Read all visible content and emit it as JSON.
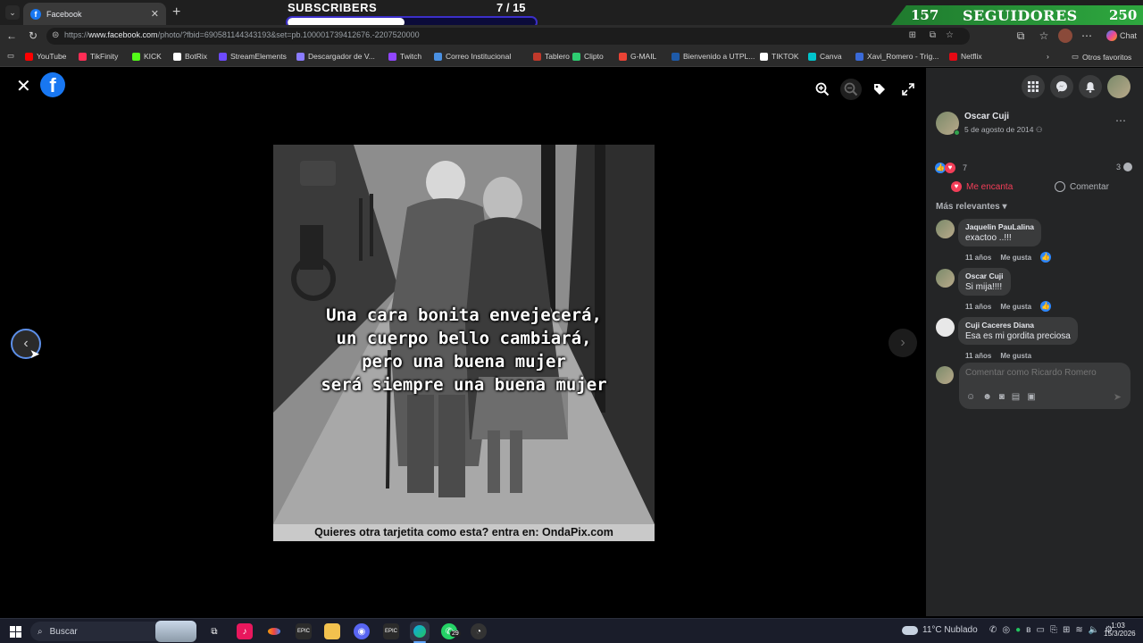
{
  "browser": {
    "tab_title": "Facebook",
    "url_prefix": "https://",
    "url_domain": "www.facebook.com",
    "url_path": "/photo/?fbid=690581144343193&set=pb.100001739412676.-2207520000",
    "chat_label": "Chat"
  },
  "overlay": {
    "subscribers_label": "SUBSCRIBERS",
    "subscribers_count": "7  / 15",
    "subscribers_progress": 0.47,
    "followers_current": "157",
    "followers_label": "SEGUIDORES",
    "followers_goal": "250"
  },
  "bookmarks": [
    {
      "label": "YouTube",
      "color": "#ff0000"
    },
    {
      "label": "TikFinity",
      "color": "#ff2d55"
    },
    {
      "label": "KICK",
      "color": "#53fc18"
    },
    {
      "label": "BotRix",
      "color": "#ffffff"
    },
    {
      "label": "StreamElements",
      "color": "#6d4aff"
    },
    {
      "label": "Descargador de V...",
      "color": "#8a7bff"
    },
    {
      "label": "Twitch",
      "color": "#9146ff"
    },
    {
      "label": "Correo Institucional",
      "color": "#4a90e2"
    },
    {
      "label": "Tablero",
      "color": "#c0392b"
    },
    {
      "label": "Clipto",
      "color": "#2ecc71"
    },
    {
      "label": "G-MAIL",
      "color": "#ea4335"
    },
    {
      "label": "Bienvenido a UTPL...",
      "color": "#1e5aa8"
    },
    {
      "label": "TIKTOK",
      "color": "#ffffff"
    },
    {
      "label": "Canva",
      "color": "#00c4cc"
    },
    {
      "label": "Xavi_Romero - Trig...",
      "color": "#3a6ad8"
    },
    {
      "label": "Netflix",
      "color": "#e50914"
    }
  ],
  "bookmarks_other": "Otros favoritos",
  "photo": {
    "caption_lines": [
      "Una cara bonita envejecerá,",
      "un cuerpo bello cambiará,",
      "pero una buena mujer",
      "será siempre una buena mujer"
    ],
    "footer": "Quieres otra tarjetita como esta? entra en: OndaPix.com"
  },
  "post": {
    "author": "Oscar Cuji",
    "date": "5 de agosto de 2014",
    "reactions_count": "7",
    "comments_count": "3",
    "love_label": "Me encanta",
    "comment_label": "Comentar",
    "sort_label": "Más relevantes",
    "comments": [
      {
        "name": "Jaquelin PauLalina",
        "text": "exactoo ..!!!",
        "time": "11 años",
        "like": "Me gusta"
      },
      {
        "name": "Oscar Cuji",
        "text": "Si mija!!!!",
        "time": "11 años",
        "like": "Me gusta"
      },
      {
        "name": "Cuji Caceres Diana",
        "text": "Esa es mi gordita preciosa",
        "time": "11 años",
        "like": "Me gusta"
      }
    ],
    "comment_placeholder": "Comentar como Ricardo Romero"
  },
  "taskbar": {
    "search_label": "Buscar",
    "whatsapp_badge": "29",
    "weather": "11°C  Nublado",
    "time": "1:03",
    "date": "15/3/2026"
  },
  "icons": {
    "prev": "chevron-left-icon",
    "next": "chevron-right-icon",
    "close": "close-icon",
    "zoom_in": "zoom-in-icon",
    "zoom_out": "zoom-out-icon",
    "tag": "tag-icon",
    "fullscreen": "fullscreen-icon"
  },
  "colors": {
    "facebook_blue": "#1877f2",
    "love_red": "#f33e58",
    "panel_bg": "#242526",
    "viewer_bg": "#000000"
  }
}
